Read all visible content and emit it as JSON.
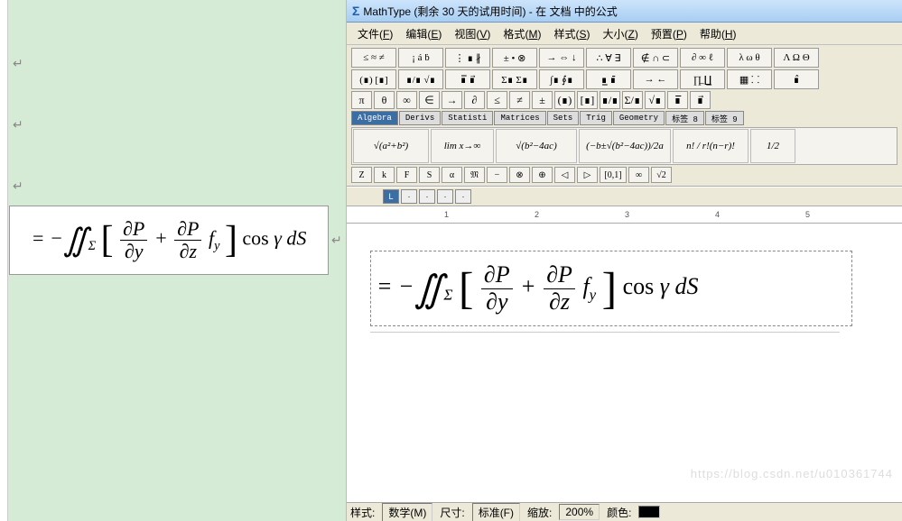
{
  "title": "MathType (剩余 30 天的试用时间) - 在 文档 中的公式",
  "menus": [
    {
      "label": "文件",
      "key": "F"
    },
    {
      "label": "编辑",
      "key": "E"
    },
    {
      "label": "视图",
      "key": "V"
    },
    {
      "label": "格式",
      "key": "M"
    },
    {
      "label": "样式",
      "key": "S"
    },
    {
      "label": "大小",
      "key": "Z"
    },
    {
      "label": "预置",
      "key": "P"
    },
    {
      "label": "帮助",
      "key": "H"
    }
  ],
  "palette_row1": [
    "≤ ≈ ≠",
    "¡ á ḃ",
    "⋮ ∎ ∦",
    "± • ⊗",
    "→ ⇔ ↓",
    "∴ ∀ ∃",
    "∉ ∩ ⊂",
    "∂ ∞ ℓ",
    "λ ω θ",
    "Λ Ω Θ"
  ],
  "palette_row2": [
    "(∎) [∎]",
    "∎/∎ √∎",
    "∎̅ ∎⃗",
    "Σ∎ Σ∎",
    "∫∎ ∮∎",
    "∎̲ ∎̄",
    "→ ←",
    "∏̲ ∐̲",
    "▦ ⸬",
    "∎̂"
  ],
  "sym_row": [
    "π",
    "θ",
    "∞",
    "∈",
    "→",
    "∂",
    "≤",
    "≠",
    "±",
    "(∎)",
    "[∎]",
    "∎/∎",
    "Σ/∎",
    "√∎",
    "∎̅",
    "∎⃗"
  ],
  "tabs": [
    {
      "label": "Algebra",
      "active": true
    },
    {
      "label": "Derivs",
      "active": false
    },
    {
      "label": "Statisti",
      "active": false
    },
    {
      "label": "Matrices",
      "active": false
    },
    {
      "label": "Sets",
      "active": false
    },
    {
      "label": "Trig",
      "active": false
    },
    {
      "label": "Geometry",
      "active": false
    },
    {
      "label": "标签 8",
      "active": false
    },
    {
      "label": "标签 9",
      "active": false
    }
  ],
  "templates": [
    "√(a²+b²)",
    "lim x→∞",
    "√(b²−4ac)",
    "(−b±√(b²−4ac))/2a",
    "n! / r!(n−r)!",
    "1/2"
  ],
  "mini_row": [
    "Z",
    "k",
    "F",
    "S",
    "α",
    "𝔐",
    "−",
    "⊗",
    "⊕",
    "◁",
    "▷",
    "[0,1]",
    "∞",
    "√2"
  ],
  "ruler": {
    "marks": [
      "1",
      "2",
      "3",
      "4",
      "5"
    ]
  },
  "status": {
    "style_label": "样式:",
    "style_val": "数学(M)",
    "size_label": "尺寸:",
    "size_val": "标准(F)",
    "zoom_label": "缩放:",
    "zoom_val": "200%",
    "color_label": "颜色:"
  },
  "watermark": "https://blog.csdn.net/u010361744",
  "formula_plain": "= −∬_Σ [ ∂P/∂y + (∂P/∂z) f_y ] cos γ dS"
}
